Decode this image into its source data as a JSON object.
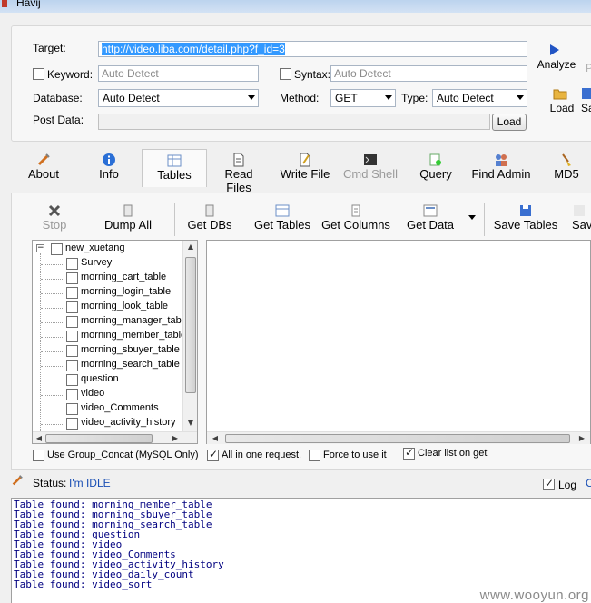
{
  "window": {
    "title": "Havij"
  },
  "form": {
    "target_label": "Target:",
    "target_value": "http://video.liba.com/detail.php?f_id=3",
    "keyword_label": "Keyword:",
    "keyword_placeholder": "Auto Detect",
    "syntax_label": "Syntax:",
    "syntax_placeholder": "Auto Detect",
    "database_label": "Database:",
    "database_value": "Auto Detect",
    "method_label": "Method:",
    "method_value": "GET",
    "type_label": "Type:",
    "type_value": "Auto Detect",
    "postdata_label": "Post Data:",
    "load_button": "Load"
  },
  "side_actions": {
    "analyze": "Analyze",
    "load": "Load",
    "save_partial": "Sa"
  },
  "tabs": [
    {
      "label": "About",
      "icon": "syringe-icon"
    },
    {
      "label": "Info",
      "icon": "info-icon"
    },
    {
      "label": "Tables",
      "icon": "tables-icon",
      "active": true
    },
    {
      "label": "Read Files",
      "icon": "file-icon"
    },
    {
      "label": "Write File",
      "icon": "write-file-icon"
    },
    {
      "label": "Cmd Shell",
      "icon": "console-icon",
      "disabled": true
    },
    {
      "label": "Query",
      "icon": "query-icon"
    },
    {
      "label": "Find Admin",
      "icon": "users-icon"
    },
    {
      "label": "MD5",
      "icon": "broom-icon"
    }
  ],
  "toolbar": {
    "stop": "Stop",
    "dump_all": "Dump All",
    "get_dbs": "Get DBs",
    "get_tables": "Get Tables",
    "get_columns": "Get Columns",
    "get_data": "Get Data",
    "save_tables": "Save Tables",
    "save_partial": "Sav"
  },
  "tree": {
    "root": "new_xuetang",
    "items": [
      "Survey",
      "morning_cart_table",
      "morning_login_table",
      "morning_look_table",
      "morning_manager_table",
      "morning_member_table",
      "morning_sbuyer_table",
      "morning_search_table",
      "question",
      "video",
      "video_Comments",
      "video_activity_history"
    ]
  },
  "options": {
    "group_concat": "Use Group_Concat (MySQL Only)",
    "all_in_one": "All in one request.",
    "force": "Force to use it",
    "clear_list": "Clear list on get"
  },
  "status": {
    "label": "Status:",
    "value": "I'm IDLE",
    "log_label": "Log"
  },
  "log_lines": [
    "Table found: morning_member_table",
    "Table found: morning_sbuyer_table",
    "Table found: morning_search_table",
    "Table found: question",
    "Table found: video",
    "Table found: video_Comments",
    "Table found: video_activity_history",
    "Table found: video_daily_count",
    "Table found: video_sort"
  ],
  "watermark": "www.wooyun.org",
  "colors": {
    "link_blue": "#1a4fb5",
    "log_text": "#000080",
    "selection": "#3399ff"
  }
}
